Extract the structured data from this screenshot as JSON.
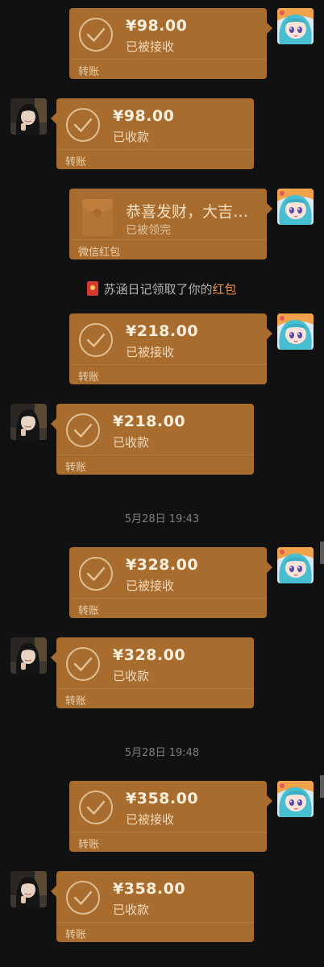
{
  "colors": {
    "background": "#111111",
    "bubble": "#A86D2E",
    "highlight": "#F0914D",
    "timestamp": "#7E7E7E"
  },
  "messages": [
    {
      "kind": "transfer",
      "side": "right",
      "amount": "¥98.00",
      "status": "已被接收",
      "caption": "转账"
    },
    {
      "kind": "transfer",
      "side": "left",
      "amount": "¥98.00",
      "status": "已收款",
      "caption": "转账"
    },
    {
      "kind": "redpacket",
      "side": "right",
      "title": "恭喜发财，大吉…",
      "status": "已被领完",
      "caption": "微信红包"
    },
    {
      "kind": "system",
      "text_prefix": "苏涵日记领取了你的",
      "text_highlight": "红包"
    },
    {
      "kind": "transfer",
      "side": "right",
      "amount": "¥218.00",
      "status": "已被接收",
      "caption": "转账"
    },
    {
      "kind": "transfer",
      "side": "left",
      "amount": "¥218.00",
      "status": "已收款",
      "caption": "转账"
    },
    {
      "kind": "time",
      "text": "5月28日 19:43"
    },
    {
      "kind": "transfer",
      "side": "right",
      "amount": "¥328.00",
      "status": "已被接收",
      "caption": "转账"
    },
    {
      "kind": "transfer",
      "side": "left",
      "amount": "¥328.00",
      "status": "已收款",
      "caption": "转账"
    },
    {
      "kind": "time",
      "text": "5月28日 19:48"
    },
    {
      "kind": "transfer",
      "side": "right",
      "amount": "¥358.00",
      "status": "已被接收",
      "caption": "转账"
    },
    {
      "kind": "transfer",
      "side": "left",
      "amount": "¥358.00",
      "status": "已收款",
      "caption": "转账"
    }
  ]
}
